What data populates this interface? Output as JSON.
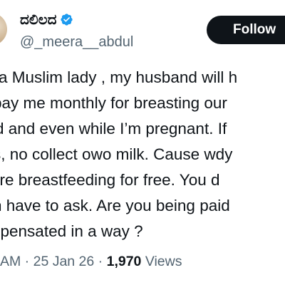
{
  "author": {
    "display_name": "ದಲಿಲದ",
    "handle": "@_meera__abdul",
    "verified_icon": "verified-badge-icon",
    "verified_color": "#1d9bf0"
  },
  "follow_button": {
    "label": "Follow"
  },
  "tweet": {
    "lines": [
      "a Muslim lady , my husband will h",
      "pay me monthly for breasting our",
      "ld and even while I’m pregnant. If",
      "s, no collect owo milk. Cause wdy",
      "are breastfeeding for free. You d",
      "n have to ask.  Are you being paid",
      "npensated in a way ?"
    ]
  },
  "meta": {
    "time": "AM",
    "separator": " · ",
    "date": "25 Jan 26",
    "views_count": "1,970",
    "views_label": " Views"
  },
  "colors": {
    "text_primary": "#0f1419",
    "text_secondary": "#536471",
    "button_bg": "#0f1419",
    "button_text": "#ffffff"
  }
}
